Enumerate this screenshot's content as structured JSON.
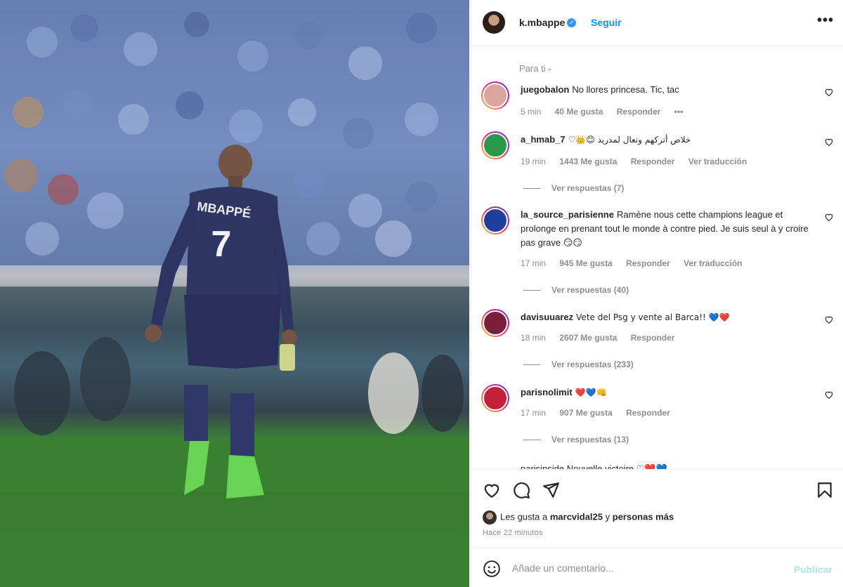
{
  "post": {
    "username": "k.mbappe",
    "follow_label": "Seguir",
    "more_label": "•••",
    "sort_label": "Para ti",
    "jersey_name": "MBAPPÉ",
    "jersey_number": "7"
  },
  "comments": [
    {
      "user": "juegobalon",
      "text": "No llores princesa. Tic, tac",
      "time": "5 min",
      "likes": "40 Me gusta",
      "reply": "Responder",
      "extra": "•••",
      "avatar_color": "#d9a7a0"
    },
    {
      "user": "a_hmab_7",
      "text": "♡👑😊 خلاص أتركهم ونعال لمدريد",
      "time": "19 min",
      "likes": "1443 Me gusta",
      "reply": "Responder",
      "extra": "Ver traducción",
      "replies": "Ver respuestas (7)",
      "avatar_color": "#2a9a4a"
    },
    {
      "user": "la_source_parisienne",
      "text": "Ramène nous cette champions league et prolonge en prenant tout le monde à contre pied. Je suis seul à y croire pas grave 😏😏",
      "time": "17 min",
      "likes": "945 Me gusta",
      "reply": "Responder",
      "extra": "Ver traducción",
      "replies": "Ver respuestas (40)",
      "avatar_color": "#1e3f9e"
    },
    {
      "user": "davisuuarez",
      "text": "Vete del Psg y vente al Barca!! 💙❤️",
      "time": "18 min",
      "likes": "2607 Me gusta",
      "reply": "Responder",
      "replies": "Ver respuestas (233)",
      "avatar_color": "#7a1e3a"
    },
    {
      "user": "parisnolimit",
      "text": "❤️💙👊",
      "time": "17 min",
      "likes": "907 Me gusta",
      "reply": "Responder",
      "replies": "Ver respuestas (13)",
      "avatar_color": "#c4203a"
    }
  ],
  "partial_comment": "parisinside Nouvelle victoire ♡❤️💙",
  "footer": {
    "likes_prefix": "Les gusta a",
    "likes_user": "marcvidal25",
    "likes_and": "y",
    "likes_more": "personas más",
    "time_ago": "Hace 22 minutos",
    "comment_placeholder": "Añade un comentario...",
    "post_label": "Publicar"
  },
  "icons": [
    "heart-icon",
    "comment-icon",
    "share-icon",
    "bookmark-icon",
    "emoji-icon",
    "verified-badge-icon",
    "chevron-down-icon"
  ]
}
